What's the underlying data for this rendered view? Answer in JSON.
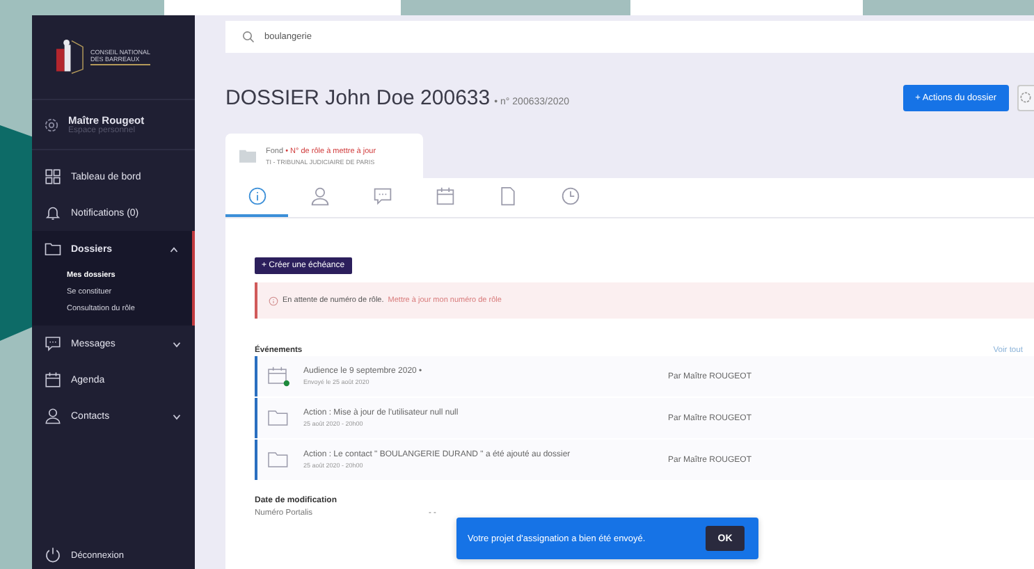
{
  "sidebar": {
    "logo_text": [
      "CONSEIL NATIONAL",
      "DES BARREAUX"
    ],
    "user": {
      "name": "Maître Rougeot",
      "subtitle": "Espace personnel"
    },
    "items": [
      {
        "kind": "grid",
        "label": "Tableau de bord",
        "selected": false
      },
      {
        "kind": "bell",
        "label": "Notifications (0)",
        "selected": false
      },
      {
        "kind": "folder",
        "label": "Dossiers",
        "expanded": true,
        "selected": true,
        "children": [
          {
            "label": "Mes dossiers",
            "selected": true
          },
          {
            "label": "Se constituer",
            "selected": false
          },
          {
            "label": "Consultation du rôle",
            "selected": false
          }
        ]
      },
      {
        "kind": "chat",
        "label": "Messages",
        "expanded": false,
        "selected": false
      },
      {
        "kind": "calendar",
        "label": "Agenda",
        "selected": false
      },
      {
        "kind": "user",
        "label": "Contacts",
        "expanded": false,
        "selected": false
      }
    ],
    "logout": "Déconnexion"
  },
  "search": {
    "value": "boulangerie"
  },
  "header": {
    "title": "DOSSIER John Doe 200633",
    "subtitle": "• n° 200633/2020",
    "action_button": "+ Actions du dossier"
  },
  "case_tab": {
    "label": "Fond",
    "warning": "• N° de rôle à mettre à jour",
    "court": "TI - TRIBUNAL JUDICIAIRE DE PARIS"
  },
  "icon_tabs": [
    {
      "kind": "info",
      "selected": true
    },
    {
      "kind": "user",
      "selected": false
    },
    {
      "kind": "chat",
      "selected": false
    },
    {
      "kind": "calendar",
      "selected": false
    },
    {
      "kind": "file",
      "selected": false
    },
    {
      "kind": "clock",
      "selected": false
    }
  ],
  "create_button": "+ Créer une échéance",
  "alert": {
    "text": "En attente de numéro de rôle.",
    "link": "Mettre à jour mon numéro de rôle"
  },
  "events": {
    "title": "Événements",
    "see_all": "Voir tout",
    "rows": [
      {
        "kind": "calendar",
        "title": "Audience le 9 septembre 2020 •",
        "subtitle": "Envoyé le 25 août 2020",
        "author": "Par Maître ROUGEOT"
      },
      {
        "kind": "folder",
        "title": "Action : Mise à jour de l'utilisateur null null",
        "subtitle": "25 août 2020 - 20h00",
        "author": "Par Maître ROUGEOT"
      },
      {
        "kind": "folder",
        "title": "Action : Le contact \" BOULANGERIE DURAND \" a été ajouté au dossier",
        "subtitle": "25 août 2020 - 20h00",
        "author": "Par Maître ROUGEOT"
      }
    ]
  },
  "details": {
    "title": "Date de modification",
    "rows": [
      {
        "label": "Numéro Portalis",
        "value": "- -"
      }
    ]
  },
  "toast": {
    "text": "Votre projet d'assignation a bien été envoyé.",
    "button": "OK"
  }
}
